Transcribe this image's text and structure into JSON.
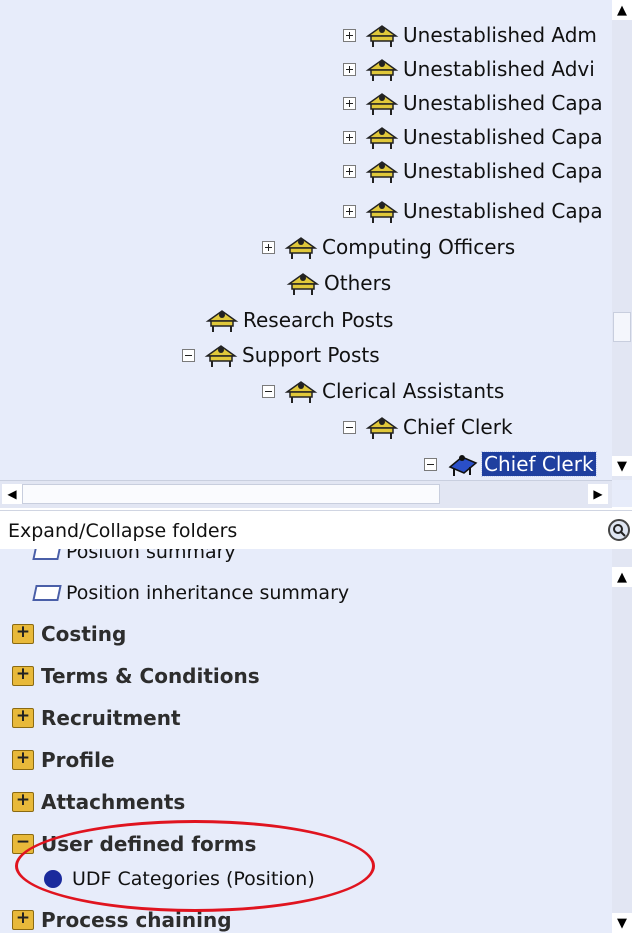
{
  "tree": {
    "items": [
      {
        "label": "Unestablished Adm",
        "expander": "plus"
      },
      {
        "label": "Unestablished Advi",
        "expander": "plus"
      },
      {
        "label": "Unestablished Capa",
        "expander": "plus"
      },
      {
        "label": "Unestablished Capa",
        "expander": "plus"
      },
      {
        "label": "Unestablished Capa",
        "expander": "plus"
      },
      {
        "label": "Unestablished Capa",
        "expander": "plus"
      },
      {
        "label": "Computing Officers",
        "expander": "plus"
      },
      {
        "label": "Others",
        "expander": "none"
      },
      {
        "label": "Research Posts",
        "expander": "none"
      },
      {
        "label": "Support Posts",
        "expander": "minus"
      },
      {
        "label": "Clerical Assistants",
        "expander": "minus"
      },
      {
        "label": "Chief Clerk",
        "expander": "minus"
      },
      {
        "label": "Chief Clerk",
        "expander": "minus",
        "selected": true
      }
    ]
  },
  "expand_bar": {
    "label": "Expand/Collapse folders",
    "icon": "search-icon"
  },
  "bottom_panel": {
    "partial_item": "Position summary",
    "inheritance_item": "Position inheritance summary",
    "folders": [
      "Costing",
      "Terms & Conditions",
      "Recruitment",
      "Profile",
      "Attachments",
      "User defined forms",
      "Process chaining"
    ],
    "udf_item": "UDF Categories (Position)"
  },
  "colors": {
    "panel_bg": "#e7ecfa",
    "selection": "#1f3f9f",
    "highlight_ellipse": "#e0141f",
    "udf_dot": "#1a2a9c"
  }
}
